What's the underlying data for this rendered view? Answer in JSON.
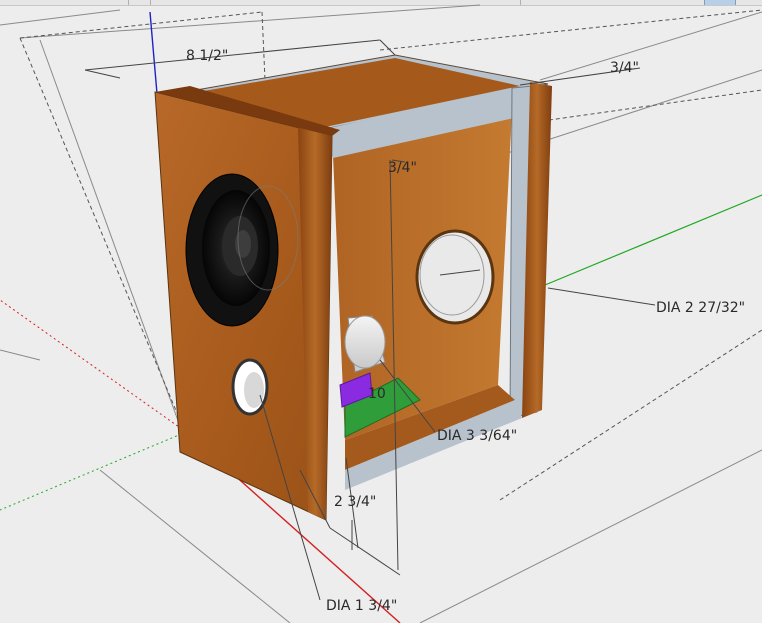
{
  "labels": {
    "width": "8 1/2\"",
    "wall_thickness": "3/4\"",
    "top_offset": "3/4\"",
    "port_rear": "DIA 2 27/32\"",
    "port_internal": "DIA 3 3/64\"",
    "port_front": "DIA 1 3/4\"",
    "bottom_offset": "2 3/4\"",
    "small_dim": "10"
  },
  "colors": {
    "background": "#ededed",
    "wood_front": "#b2651f",
    "wood_side": "#8f4c17",
    "wood_inner": "#c0772c",
    "board_gray": "#b7c2cc",
    "pcb_green": "#2f9e3a",
    "component_purple": "#8a2be2",
    "axis_red": "#d42020",
    "axis_green": "#21a821",
    "axis_blue": "#2020c8"
  }
}
